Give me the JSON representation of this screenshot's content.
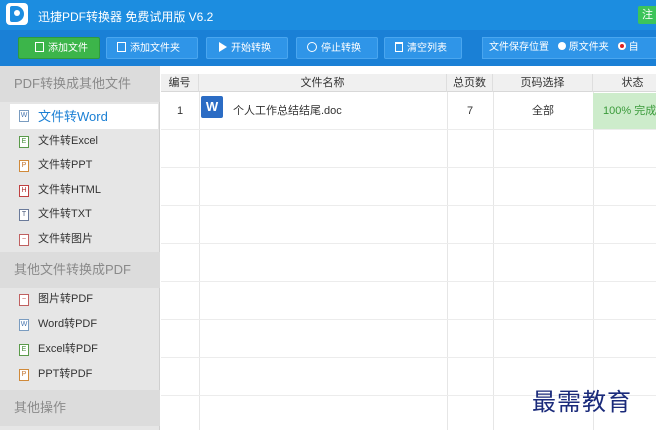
{
  "window": {
    "title": "迅捷PDF转换器 免费试用版 V6.2",
    "corner_button": "注"
  },
  "toolbar": {
    "add_file": "添加文件",
    "add_folder": "添加文件夹",
    "start": "开始转换",
    "stop": "停止转换",
    "clear": "清空列表",
    "save_location_label": "文件保存位置",
    "save_options": [
      "原文件夹",
      "自"
    ],
    "selected_save_option": "自"
  },
  "sidebar": {
    "section1_title": "PDF转换成其他文件",
    "section1_items": [
      {
        "label": "文件转Word",
        "icon": "word-file-icon",
        "active": true
      },
      {
        "label": "文件转Excel",
        "icon": "excel-file-icon"
      },
      {
        "label": "文件转PPT",
        "icon": "ppt-file-icon"
      },
      {
        "label": "文件转HTML",
        "icon": "html-file-icon"
      },
      {
        "label": "文件转TXT",
        "icon": "txt-file-icon"
      },
      {
        "label": "文件转图片",
        "icon": "image-file-icon"
      }
    ],
    "section2_title": "其他文件转换成PDF",
    "section2_items": [
      {
        "label": "图片转PDF",
        "icon": "image-file-icon"
      },
      {
        "label": "Word转PDF",
        "icon": "word-file-icon"
      },
      {
        "label": "Excel转PDF",
        "icon": "excel-file-icon"
      },
      {
        "label": "PPT转PDF",
        "icon": "ppt-file-icon"
      }
    ],
    "section3_title": "其他操作"
  },
  "table": {
    "headers": [
      "编号",
      "文件名称",
      "总页数",
      "页码选择",
      "状态"
    ],
    "rows": [
      {
        "index": "1",
        "icon_letter": "W",
        "name": "个人工作总结结尾.doc",
        "pages": "7",
        "page_select": "全部",
        "status": "100% 完成"
      }
    ]
  },
  "watermark": "最需教育",
  "colors": {
    "titlebar": "#1c8de0",
    "toolbar": "#1a80d6",
    "add_button_green": "#3cb54a",
    "sidebar_active_text": "#1a7fd4",
    "status_complete_bg": "#cdeccb",
    "status_complete_text": "#3a9a3a",
    "word_icon": "#2b6cc4"
  }
}
